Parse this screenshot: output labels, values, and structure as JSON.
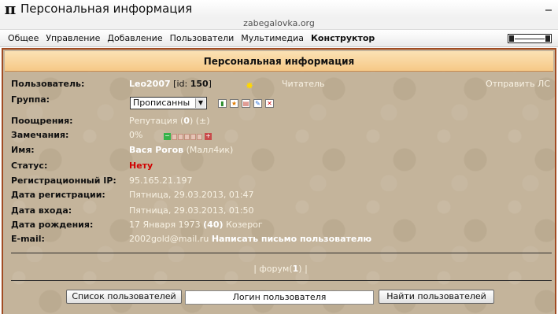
{
  "window": {
    "app_icon_glyph": "π",
    "title": "Персональная информация",
    "url": "zabegalovka.org"
  },
  "menu": [
    "Общее",
    "Управление",
    "Добавление",
    "Пользователи",
    "Мультимедиа",
    "Конструктор"
  ],
  "page": {
    "header": "Персональная информация",
    "send_ls": "Отправить ЛС",
    "labels": {
      "user": "Пользователь:",
      "group": "Группа:",
      "rewards": "Поощрения:",
      "remarks": "Замечания:",
      "name": "Имя:",
      "status": "Статус:",
      "reg_ip": "Регистрационный IP:",
      "reg_date": "Дата регистрации:",
      "login_date": "Дата входа:",
      "birth_date": "Дата рождения:",
      "email": "E-mail:"
    },
    "user": {
      "username": "Leo2007",
      "id_prefix": "[id:",
      "id_value": "150",
      "id_suffix": "]",
      "role": "Читатель",
      "role_icon": "star-icon"
    },
    "group": {
      "selected": "Прописанны",
      "tools": [
        "chart-icon",
        "star-icon",
        "document-icon",
        "edit-icon",
        "delete-icon"
      ]
    },
    "rewards": {
      "text_prefix": "Репутация (",
      "value": "0",
      "text_suffix": ") (±)"
    },
    "remarks": {
      "percent": "0%",
      "level": 0
    },
    "name": {
      "full": "Вася Рогов",
      "nick": "(Малл4ик)"
    },
    "status": "Нету",
    "reg_ip": "95.165.21.197",
    "reg_date": "Пятница, 29.03.2013, 01:47",
    "login_date": "Пятница, 29.03.2013, 01:50",
    "birth": {
      "date": "17 Января 1973",
      "age": "(40)",
      "sign": "Козерог"
    },
    "email": {
      "address": "2002gold@mail.ru",
      "link": "Написать письмо пользователю"
    },
    "forum": {
      "prefix": "| форум(",
      "count": "1",
      "suffix": ") |"
    }
  },
  "bottom": {
    "user_list_button": "Список пользователей",
    "search_value": "Логин пользователя",
    "find_button": "Найти пользователей"
  },
  "colors": {
    "frame_border": "#a14b22",
    "header_bg": "#f6c987",
    "background": "#c4b49b",
    "status_red": "#d00000"
  }
}
